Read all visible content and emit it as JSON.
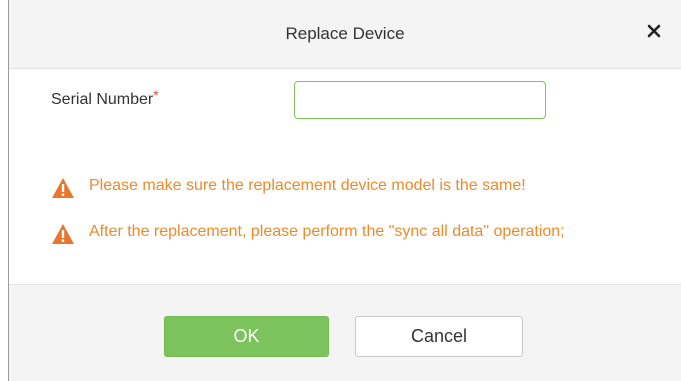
{
  "dialog": {
    "title": "Replace Device",
    "close_icon": "close-icon"
  },
  "form": {
    "serial_label": "Serial Number",
    "required_mark": "*",
    "serial_value": "",
    "serial_placeholder": ""
  },
  "warnings": [
    {
      "icon": "warning-icon",
      "text": "Please make sure the replacement device model is the same!"
    },
    {
      "icon": "warning-icon",
      "text": "After the replacement, please perform the \"sync all data\" operation;"
    }
  ],
  "buttons": {
    "ok_label": "OK",
    "cancel_label": "Cancel"
  },
  "colors": {
    "accent_green": "#7cc35d",
    "warning_orange": "#ee8a2a",
    "required_red": "#e24b4b",
    "header_bg": "#f4f4f4"
  }
}
